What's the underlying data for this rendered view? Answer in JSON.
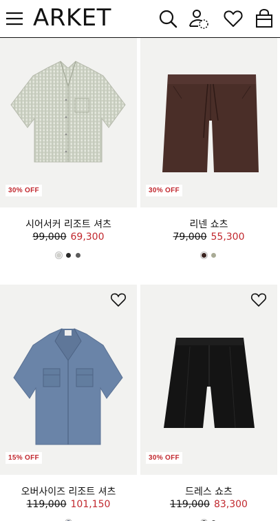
{
  "header": {
    "logo": "ARKET",
    "icons": [
      "menu-icon",
      "search-icon",
      "account-icon",
      "heart-icon",
      "shopping-bag-icon"
    ]
  },
  "colors": {
    "sale": "#c1272d",
    "text": "#111111",
    "image_bg": "#f2f2f0"
  },
  "products": [
    {
      "name": "시어서커 리조트 셔츠",
      "old_price": "99,000",
      "new_price": "69,300",
      "badge": "30% OFF",
      "swatches": [
        "#d0d0cc",
        "#2a2a2a",
        "#5c5c5c"
      ]
    },
    {
      "name": "리넨 쇼츠",
      "old_price": "79,000",
      "new_price": "55,300",
      "badge": "30% OFF",
      "swatches": [
        "#3a2420",
        "#a9ab96"
      ]
    },
    {
      "name": "오버사이즈 리조트 셔츠",
      "old_price": "119,000",
      "new_price": "101,150",
      "badge": "15% OFF",
      "swatches": [
        "#3d4a66"
      ]
    },
    {
      "name": "드레스 쇼츠",
      "old_price": "119,000",
      "new_price": "83,300",
      "badge": "30% OFF",
      "swatches": [
        "#1a1a1a",
        "#3c3c3c"
      ]
    }
  ]
}
